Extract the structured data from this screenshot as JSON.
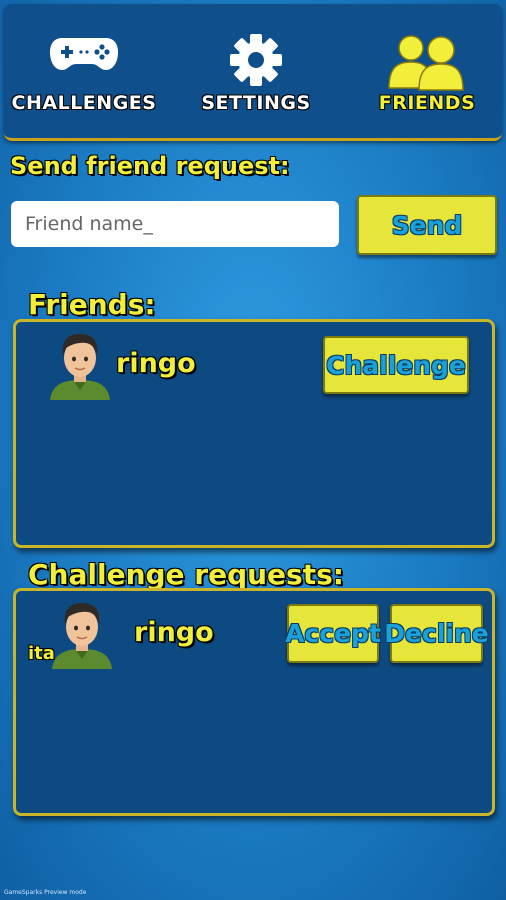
{
  "tabs": {
    "challenges": {
      "label": "CHALLENGES",
      "icon": "gamepad-icon"
    },
    "settings": {
      "label": "SETTINGS",
      "icon": "gear-icon"
    },
    "friends": {
      "label": "FRIENDS",
      "icon": "friends-icon",
      "active": true
    }
  },
  "send_request": {
    "title": "Send friend request:",
    "placeholder": "Friend name_",
    "value": "",
    "button_label": "Send"
  },
  "friends": {
    "title": "Friends:",
    "items": [
      {
        "name": "ringo",
        "avatar": "male-avatar-icon",
        "action_label": "Challenge"
      }
    ]
  },
  "challenge_requests": {
    "title": "Challenge requests:",
    "items": [
      {
        "name": "ringo",
        "avatar_tag": "ita",
        "avatar": "male-avatar-icon",
        "accept_label": "Accept",
        "decline_label": "Decline"
      }
    ]
  },
  "footer": {
    "text": "GameSparks Preview mode"
  },
  "colors": {
    "background": "#1b7cc4",
    "topbar": "#0f4f8c",
    "panel": "#0e4a82",
    "panel_border": "#c9b52a",
    "accent_yellow": "#f2ef3a",
    "button_yellow": "#e6e63a",
    "button_text_blue": "#1aa1d9"
  }
}
